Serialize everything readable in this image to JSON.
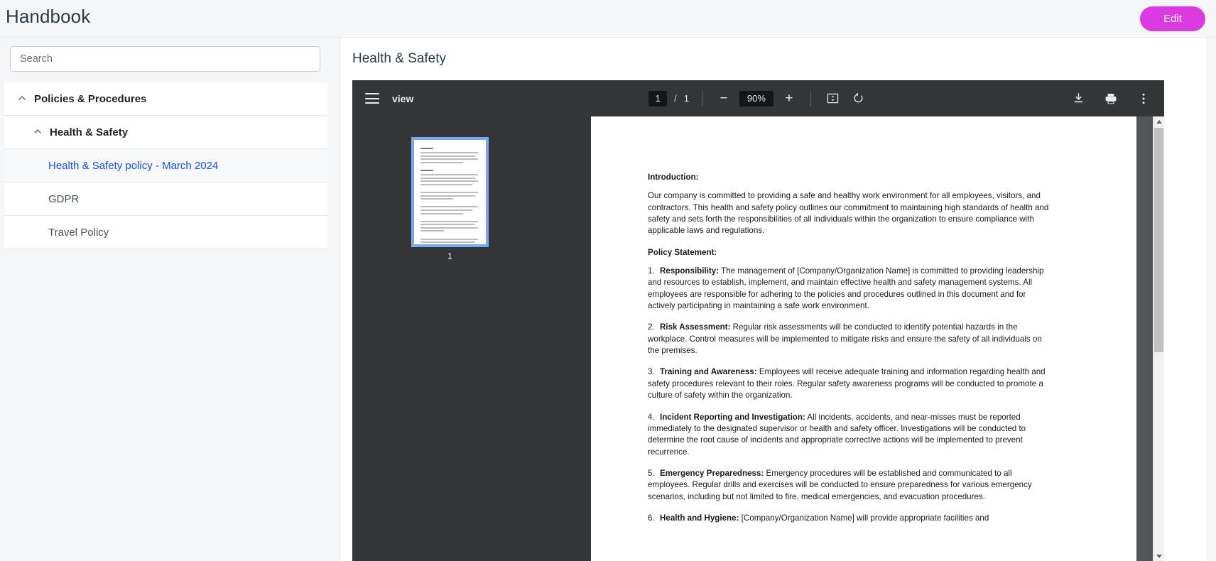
{
  "app": {
    "title": "Handbook",
    "edit_button_label": "Edit",
    "accent_color": "#dd39e0"
  },
  "search": {
    "placeholder": "Search",
    "value": ""
  },
  "sidebar": {
    "items": [
      {
        "label": "Policies & Procedures",
        "level": 0,
        "expanded": true,
        "icon": "chevron-up-icon",
        "selected": false
      },
      {
        "label": "Health & Safety",
        "level": 1,
        "expanded": true,
        "icon": "chevron-up-icon",
        "selected": false
      },
      {
        "label": "Health & Safety policy - March 2024",
        "level": 2,
        "expanded": null,
        "icon": "",
        "selected": true
      },
      {
        "label": "GDPR",
        "level": 2,
        "expanded": null,
        "icon": "",
        "selected": false
      },
      {
        "label": "Travel Policy",
        "level": 2,
        "expanded": null,
        "icon": "",
        "selected": false
      }
    ]
  },
  "content": {
    "title": "Health & Safety"
  },
  "pdf_toolbar": {
    "menu_icon": "hamburger-menu-icon",
    "view_label": "view",
    "page_number": "1",
    "page_separator": "/",
    "page_total": "1",
    "zoom_out_label": "−",
    "zoom_level": "90%",
    "zoom_in_label": "+",
    "fit_page_icon": "fit-to-page-icon",
    "rotate_icon": "rotate-counterclockwise-icon",
    "download_icon": "download-icon",
    "print_icon": "print-icon",
    "more_icon": "more-vertical-icon"
  },
  "thumbnails": {
    "pages": [
      {
        "number": "1",
        "selected": true
      }
    ]
  },
  "document": {
    "intro_heading": "Introduction:",
    "intro_paragraph": "Our company is committed to providing a safe and healthy work environment for all employees, visitors, and contractors. This health and safety policy outlines our commitment to maintaining high standards of health and safety and sets forth the responsibilities of all individuals within the organization to ensure compliance with applicable laws and regulations.",
    "policy_heading": "Policy Statement:",
    "items": [
      {
        "number": "1.",
        "term": "Responsibility:",
        "text": " The management of [Company/Organization Name] is committed to providing leadership and resources to establish, implement, and maintain effective health and safety management systems. All employees are responsible for adhering to the policies and procedures outlined in this document and for actively participating in maintaining a safe work environment."
      },
      {
        "number": "2.",
        "term": "Risk Assessment:",
        "text": " Regular risk assessments will be conducted to identify potential hazards in the workplace. Control measures will be implemented to mitigate risks and ensure the safety of all individuals on the premises."
      },
      {
        "number": "3.",
        "term": "Training and Awareness:",
        "text": " Employees will receive adequate training and information regarding health and safety procedures relevant to their roles. Regular safety awareness programs will be conducted to promote a culture of safety within the organization."
      },
      {
        "number": "4.",
        "term": "Incident Reporting and Investigation:",
        "text": " All incidents, accidents, and near-misses must be reported immediately to the designated supervisor or health and safety officer. Investigations will be conducted to determine the root cause of incidents and appropriate corrective actions will be implemented to prevent recurrence."
      },
      {
        "number": "5.",
        "term": "Emergency Preparedness:",
        "text": " Emergency procedures will be established and communicated to all employees. Regular drills and exercises will be conducted to ensure preparedness for various emergency scenarios, including but not limited to fire, medical emergencies, and evacuation procedures."
      },
      {
        "number": "6.",
        "term": "Health and Hygiene:",
        "text": " [Company/Organization Name] will provide appropriate facilities and"
      }
    ]
  }
}
